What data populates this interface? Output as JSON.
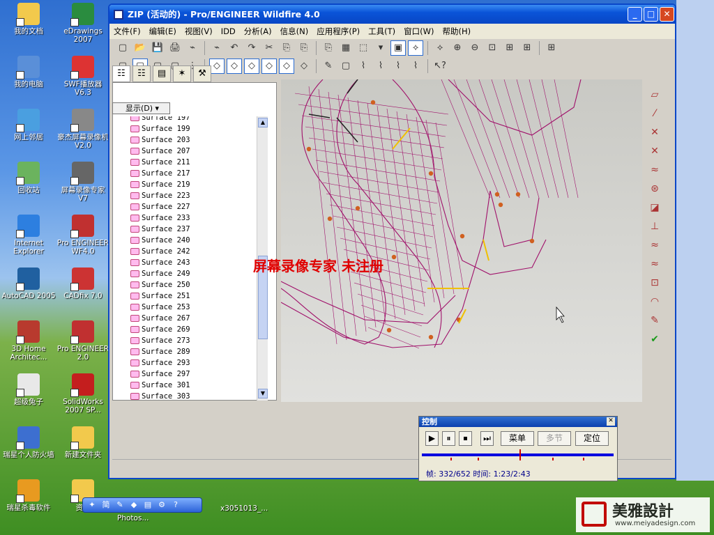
{
  "desktop": {
    "icons": [
      {
        "label": "我的文档",
        "color": "#f2c94c"
      },
      {
        "label": "eDrawings 2007",
        "color": "#2a8c3f"
      },
      {
        "label": "我的电脑",
        "color": "#5a8fd8"
      },
      {
        "label": "SWF播放器 V6.3",
        "color": "#d33"
      },
      {
        "label": "网上邻居",
        "color": "#4a9fe0"
      },
      {
        "label": "豪杰屏幕录像机 V2.0",
        "color": "#888"
      },
      {
        "label": "回收站",
        "color": "#6bb35e"
      },
      {
        "label": "屏幕录像专家 V7",
        "color": "#666"
      },
      {
        "label": "Internet Explorer",
        "color": "#2d7fe0"
      },
      {
        "label": "Pro ENGINEER WF4.0",
        "color": "#c03030"
      },
      {
        "label": "AutoCAD 2005",
        "color": "#2060a0"
      },
      {
        "label": "CADfix 7.0",
        "color": "#c33"
      },
      {
        "label": "3D Home Architec...",
        "color": "#b83a2e"
      },
      {
        "label": "Pro ENGINEER 2.0",
        "color": "#c03030"
      },
      {
        "label": "超级兔子",
        "color": "#e8e8e8"
      },
      {
        "label": "SolidWorks 2007 SP...",
        "color": "#c41e1e"
      },
      {
        "label": "瑞星个人防火墙",
        "color": "#3d6fd0"
      },
      {
        "label": "新建文件夹",
        "color": "#f2c94c"
      },
      {
        "label": "瑞星杀毒软件",
        "color": "#e89a20"
      },
      {
        "label": "资料",
        "color": "#f2c94c"
      }
    ],
    "taskbar_items": [
      "Photos...",
      "x3051013_..."
    ]
  },
  "window": {
    "title": "ZIP (活动的) - Pro/ENGINEER Wildfire 4.0",
    "menu": [
      "文件(F)",
      "编辑(E)",
      "视图(V)",
      "IDD",
      "分析(A)",
      "信息(N)",
      "应用程序(P)",
      "工具(T)",
      "窗口(W)",
      "帮助(H)"
    ],
    "toolbar1": [
      "▢",
      "📂",
      "💾",
      "🖨",
      "⌁",
      "⌁",
      "↶",
      "↷",
      "✂",
      "⎘",
      "⎘",
      "⎘",
      "▦",
      "⬚",
      "▾",
      "▣",
      "⟡",
      "⟡",
      "⊕",
      "⊖",
      "⊡",
      "⊞",
      "⊞",
      "⊞"
    ],
    "toolbar2": [
      "▢",
      "▢",
      "▢",
      "▢",
      "⋮",
      "◇",
      "◇",
      "◇",
      "◇",
      "◇",
      "◇",
      "✎",
      "▢",
      "⌇",
      "⌇",
      "⌇",
      "⌇",
      "↖?"
    ],
    "show_label": "显示(D) ▾",
    "surfaces": [
      "Surface 197",
      "Surface 199",
      "Surface 203",
      "Surface 207",
      "Surface 211",
      "Surface 217",
      "Surface 219",
      "Surface 223",
      "Surface 227",
      "Surface 233",
      "Surface 237",
      "Surface 240",
      "Surface 242",
      "Surface 243",
      "Surface 249",
      "Surface 250",
      "Surface 251",
      "Surface 253",
      "Surface 267",
      "Surface 269",
      "Surface 273",
      "Surface 289",
      "Surface 293",
      "Surface 297",
      "Surface 301",
      "Surface 303"
    ],
    "right_tools": [
      "▱",
      "⁄",
      "✕",
      "✕",
      "≈",
      "⊛",
      "◪",
      "⊥",
      "≈",
      "≈",
      "⊡",
      "◠",
      "✎",
      "✔"
    ]
  },
  "watermark": "屏幕录像专家 未注册",
  "control": {
    "title": "控制",
    "buttons": [
      "▶",
      "⏸",
      "⏹",
      "⏭"
    ],
    "menu": "菜单",
    "section": "多节",
    "locate": "定位",
    "info": "帧: 332/652 时间: 1:23/2:43",
    "progress": 0.509
  },
  "logo": {
    "text": "美雅設計",
    "url": "www.meiyadesign.com"
  },
  "colors": {
    "accent": "#0a54d8",
    "mesh": "#a0106a",
    "node": "#d06020"
  }
}
